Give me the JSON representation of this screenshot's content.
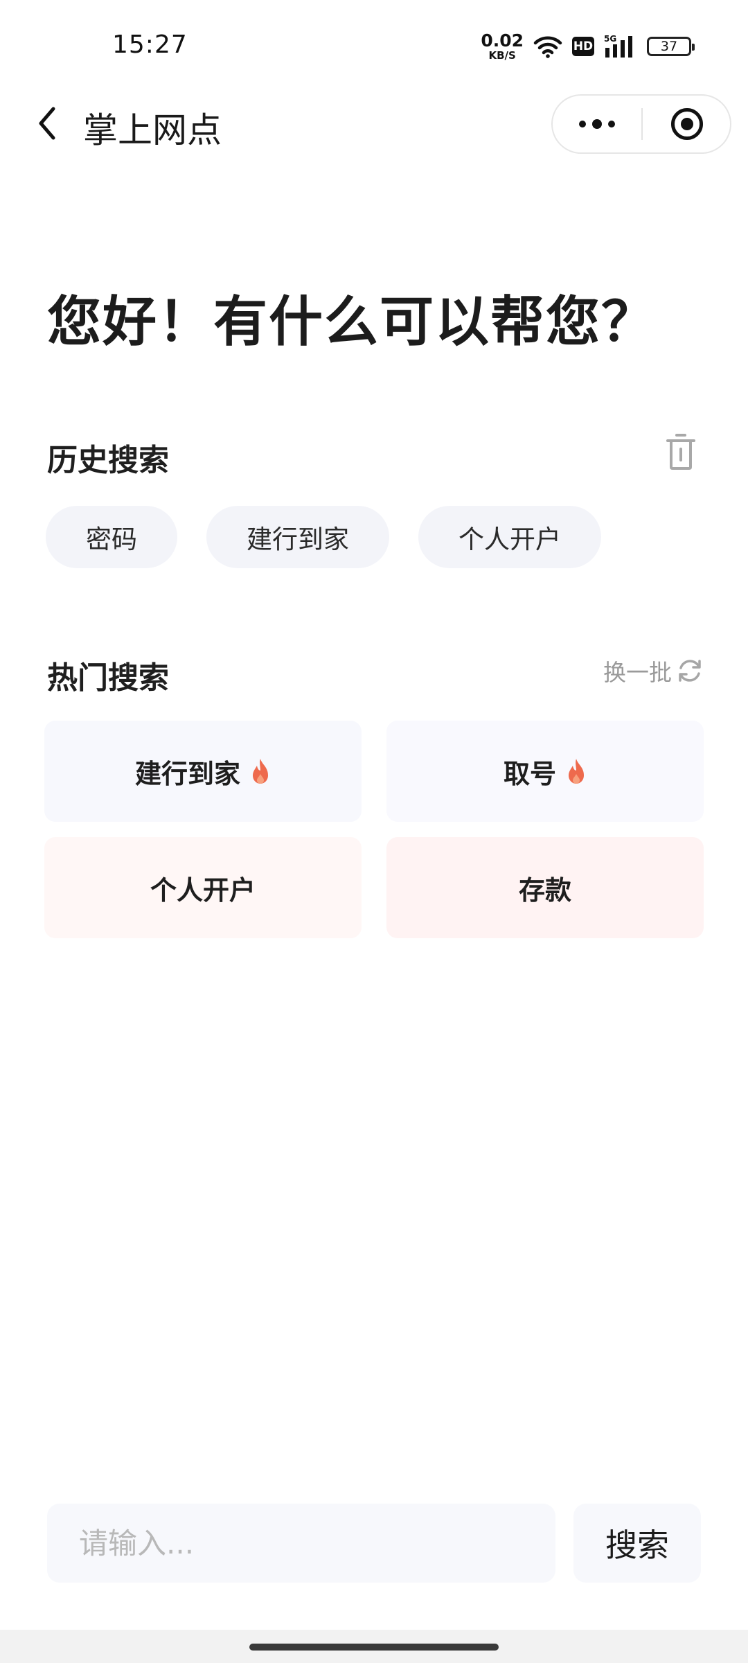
{
  "status_bar": {
    "time": "15:27",
    "net_speed_value": "0.02",
    "net_speed_unit": "KB/S",
    "hd_label": "HD",
    "signal_label": "5G",
    "battery_level": "37"
  },
  "header": {
    "title": "掌上网点",
    "icons": [
      "back-arrow-icon",
      "more-dots-icon",
      "target-close-icon"
    ]
  },
  "greeting": "您好！有什么可以帮您？",
  "history": {
    "title": "历史搜索",
    "items": [
      "密码",
      "建行到家",
      "个人开户"
    ]
  },
  "hot": {
    "title": "热门搜索",
    "refresh_label": "换一批",
    "items": [
      {
        "label": "建行到家",
        "hot": true
      },
      {
        "label": "取号",
        "hot": true
      },
      {
        "label": "个人开户",
        "hot": false
      },
      {
        "label": "存款",
        "hot": false
      }
    ],
    "colors": {
      "flame": "#ec5a3a"
    }
  },
  "search": {
    "placeholder": "请输入...",
    "button_label": "搜索"
  }
}
